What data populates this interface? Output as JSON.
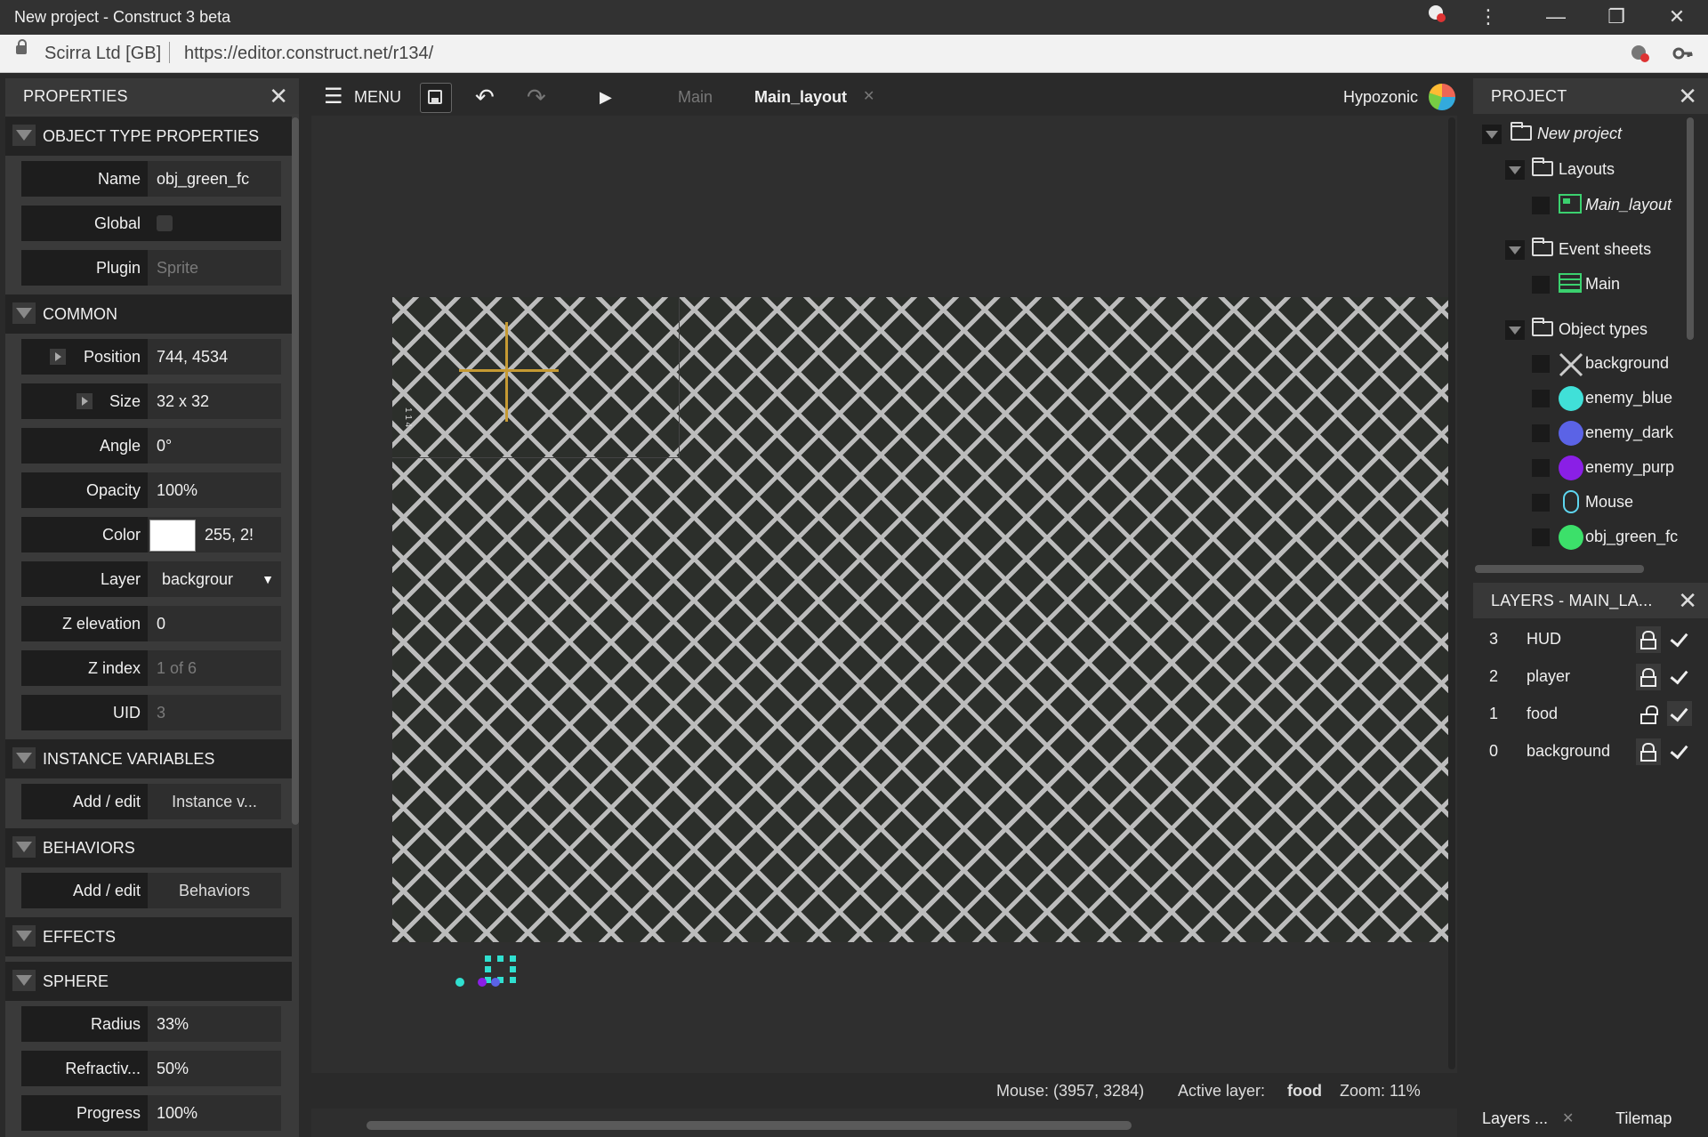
{
  "window": {
    "title": "New project - Construct 3 beta",
    "controls": {
      "more": "⋮",
      "minimize": "—",
      "restore": "❐",
      "close": "✕"
    }
  },
  "address_bar": {
    "org": "Scirra Ltd [GB]",
    "url": "https://editor.construct.net/r134/"
  },
  "properties": {
    "title": "PROPERTIES",
    "close": "✕",
    "sections": {
      "object_type": "OBJECT TYPE PROPERTIES",
      "common": "COMMON",
      "instance_vars": "INSTANCE VARIABLES",
      "behaviors": "BEHAVIORS",
      "effects": "EFFECTS",
      "sphere": "SPHERE"
    },
    "rows": {
      "name": {
        "label": "Name",
        "value": "obj_green_fc"
      },
      "global": {
        "label": "Global"
      },
      "plugin": {
        "label": "Plugin",
        "value": "Sprite"
      },
      "position": {
        "label": "Position",
        "value": "744, 4534"
      },
      "size": {
        "label": "Size",
        "value": "32 x 32"
      },
      "angle": {
        "label": "Angle",
        "value": "0°"
      },
      "opacity": {
        "label": "Opacity",
        "value": "100%"
      },
      "color": {
        "label": "Color",
        "value": "255, 2!",
        "swatch": "#ffffff"
      },
      "layer": {
        "label": "Layer",
        "value": "backgrour",
        "arrow": "▼"
      },
      "z_elevation": {
        "label": "Z elevation",
        "value": "0"
      },
      "z_index": {
        "label": "Z index",
        "value": "1 of 6"
      },
      "uid": {
        "label": "UID",
        "value": "3"
      },
      "instance_vars": {
        "label": "Add / edit",
        "value": "Instance v..."
      },
      "behaviors": {
        "label": "Add / edit",
        "value": "Behaviors"
      },
      "radius": {
        "label": "Radius",
        "value": "33%"
      },
      "refraction": {
        "label": "Refractiv...",
        "value": "50%"
      },
      "progress": {
        "label": "Progress",
        "value": "100%"
      }
    }
  },
  "layout_view": {
    "toolbar": {
      "menu": "MENU",
      "menu_icon": "☰",
      "undo_icon": "↶",
      "redo_icon": "↷",
      "play_icon": "▶",
      "tab_main": "Main",
      "tab_layout": "Main_layout",
      "tab_close": "✕",
      "user": "Hypozonic"
    },
    "status": {
      "mouse": "Mouse: (3957, 3284)",
      "active_layer_label": "Active layer:",
      "active_layer": "food",
      "zoom": "Zoom: 11%"
    },
    "tile_label": "1 1 4"
  },
  "project": {
    "title": "PROJECT",
    "close": "✕",
    "items": {
      "root": "New project",
      "layouts": "Layouts",
      "main_layout": "Main_layout",
      "event_sheets": "Event sheets",
      "main_sheet": "Main",
      "object_types": "Object types",
      "obj1": {
        "label": "background"
      },
      "obj2": {
        "label": "enemy_blue",
        "color": "#40e0d8"
      },
      "obj3": {
        "label": "enemy_dark",
        "color": "#5b63e6"
      },
      "obj4": {
        "label": "enemy_purp",
        "color": "#8a1fe6"
      },
      "obj5": {
        "label": "Mouse"
      },
      "obj6": {
        "label": "obj_green_fc",
        "color": "#3ce06a"
      }
    }
  },
  "layers": {
    "title": "LAYERS - MAIN_LA...",
    "close": "✕",
    "rows": [
      {
        "n": "3",
        "name": "HUD"
      },
      {
        "n": "2",
        "name": "player"
      },
      {
        "n": "1",
        "name": "food"
      },
      {
        "n": "0",
        "name": "background"
      }
    ],
    "tabs": {
      "layers": "Layers ...",
      "close": "✕",
      "tilemap": "Tilemap"
    }
  }
}
